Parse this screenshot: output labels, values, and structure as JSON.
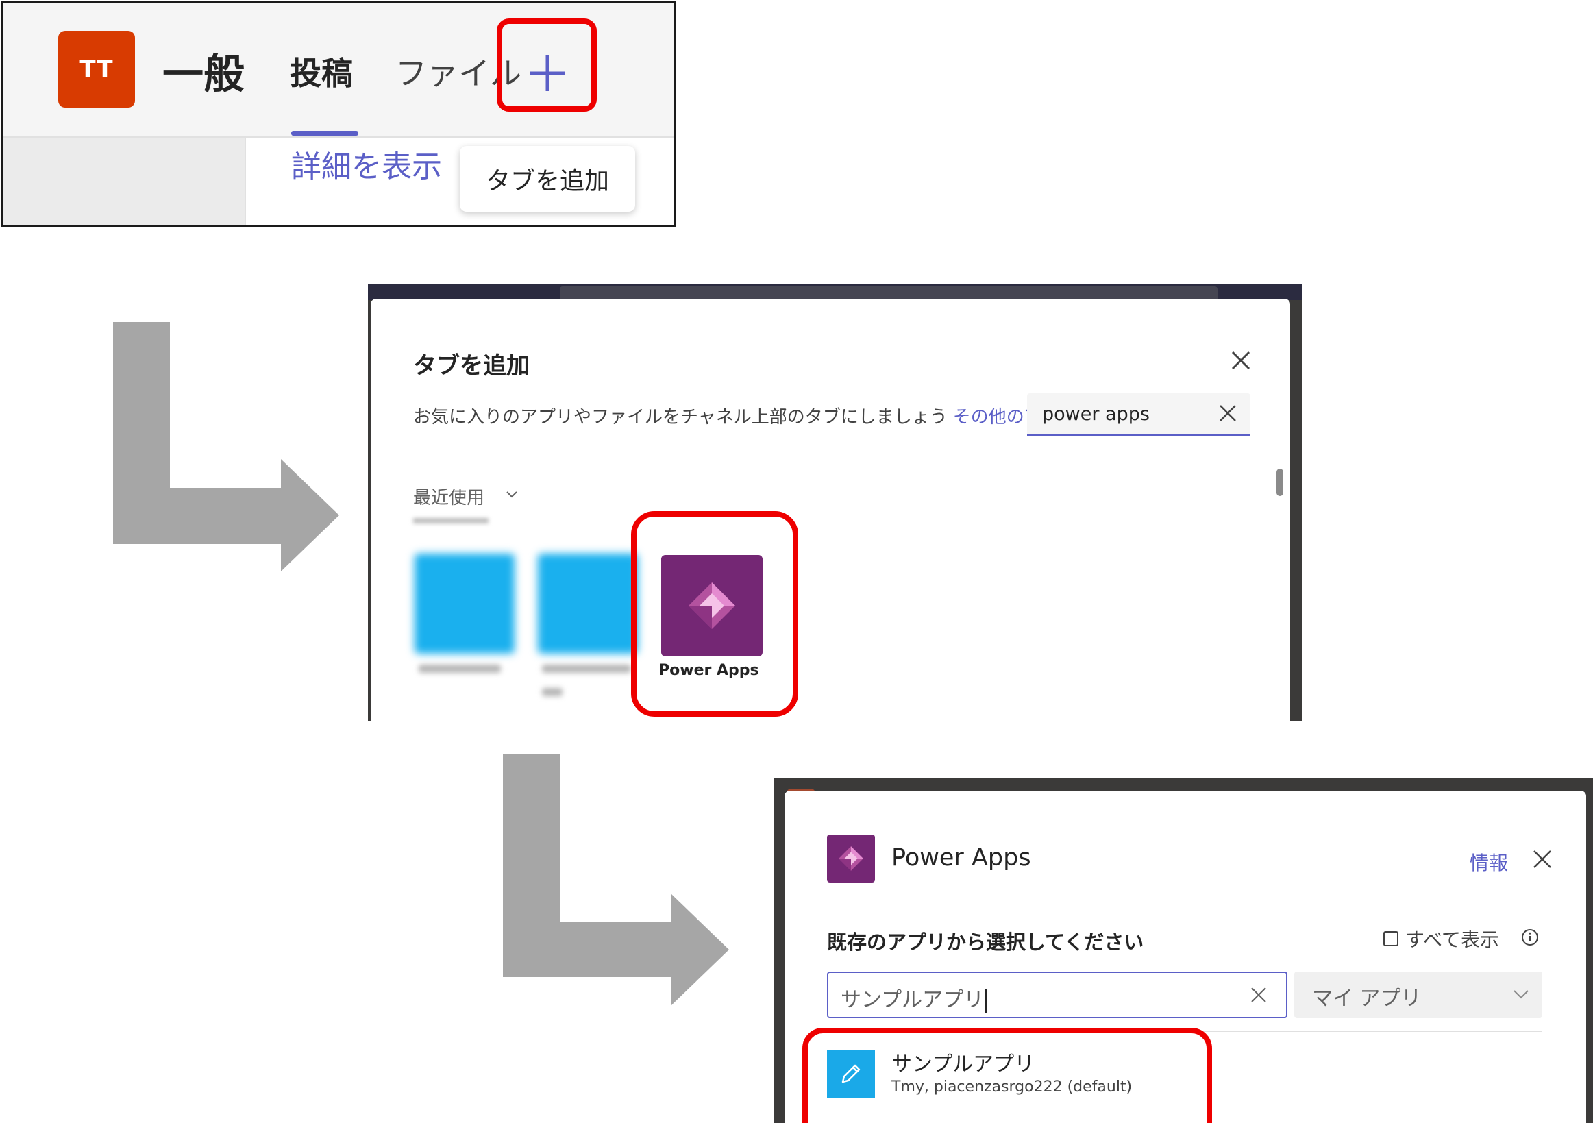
{
  "panel1": {
    "avatar_initials": "TT",
    "channel_name": "一般",
    "tabs": [
      {
        "label": "投稿",
        "active": true
      },
      {
        "label": "ファイル",
        "active": false
      }
    ],
    "add_tab_icon": "plus-icon",
    "show_more_link": "詳細を表示",
    "tooltip": "タブを追加"
  },
  "panel2": {
    "title": "タブを追加",
    "subtitle": "お気に入りのアプリやファイルをチャネル上部のタブにしましょう",
    "other_apps_link": "その他のアプリ",
    "search_value": "power apps",
    "recent_label": "最近使用",
    "apps": [
      {
        "label": "Power Apps",
        "icon": "power-apps-icon"
      }
    ]
  },
  "panel3": {
    "title": "Power Apps",
    "info_link": "情報",
    "select_label": "既存のアプリから選択してください",
    "show_all_label": "すべて表示",
    "search_value": "サンプルアプリ",
    "filter_value": "マイ アプリ",
    "results": [
      {
        "name": "サンプルアプリ",
        "detail": "Tmy, piacenzasrgo222 (default)",
        "icon": "pencil-icon"
      }
    ]
  },
  "colors": {
    "accent": "#5b5fc7",
    "highlight": "#ee0000",
    "avatar": "#d83b01",
    "power_apps": "#742774",
    "app_tile": "#1aa9e8",
    "arrow": "#a6a6a6"
  }
}
